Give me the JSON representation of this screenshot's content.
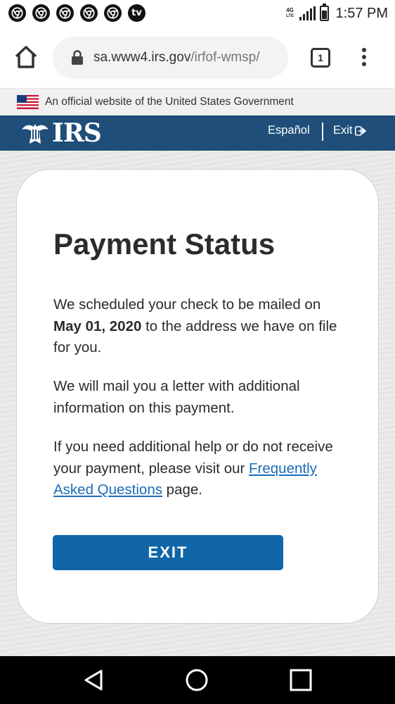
{
  "status_bar": {
    "notifications": [
      "chrome-icon",
      "chrome-icon",
      "chrome-icon",
      "chrome-icon",
      "chrome-icon",
      "tv-app-icon"
    ],
    "tv_label": "tv",
    "network": "4G LTE",
    "time": "1:57 PM"
  },
  "browser": {
    "url_host": "sa.www4.irs.gov",
    "url_path": "/irfof-wmsp/",
    "tab_count": "1"
  },
  "gov_banner": {
    "text": "An official website of the United States Government"
  },
  "irs_header": {
    "logo_text": "IRS",
    "language_link": "Español",
    "exit_link": "Exit"
  },
  "card": {
    "title": "Payment Status",
    "para1_before": "We scheduled your check to be mailed on ",
    "para1_date": "May 01, 2020",
    "para1_after": " to the address we have on file for you.",
    "para2": "We will mail you a letter with additional information on this payment.",
    "para3_before": "If you need additional help or do not receive your payment, please visit our ",
    "para3_link": "Frequently Asked Questions",
    "para3_after": " page.",
    "exit_button": "EXIT"
  },
  "colors": {
    "irs_header_bg": "#1e4e79",
    "button_bg": "#1066a8",
    "link": "#1b6cb8"
  }
}
